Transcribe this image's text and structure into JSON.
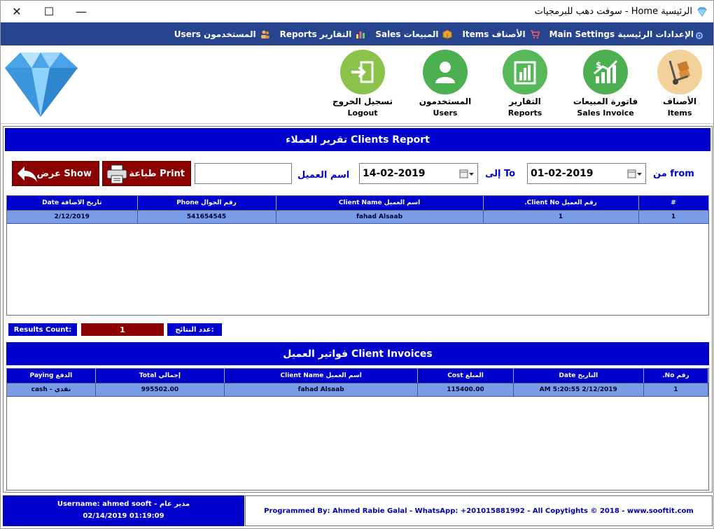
{
  "window": {
    "title": "الرئيسية Home - سوفت دهب للبرمجيات",
    "minimize_glyph": "—",
    "maximize_glyph": "☐",
    "close_glyph": "✕"
  },
  "menu": {
    "items": [
      {
        "label": "الإعدادات الرئيسية Main Settings",
        "icon": "gear-icon"
      },
      {
        "label": "الأصناف Items",
        "icon": "cart-icon"
      },
      {
        "label": "المبيعات Sales",
        "icon": "box-icon"
      },
      {
        "label": "التقارير Reports",
        "icon": "chart-icon"
      },
      {
        "label": "المستخدمون Users",
        "icon": "users-icon"
      }
    ]
  },
  "toolbar": {
    "items": {
      "ar": "الأصناف",
      "en": "Items"
    },
    "sales": {
      "ar": "فاتورة المبيعات",
      "en": "Sales Invoice"
    },
    "reports": {
      "ar": "التقارير",
      "en": "Reports"
    },
    "users": {
      "ar": "المستخدمون",
      "en": "Users"
    },
    "logout": {
      "ar": "تسجيل الخروج",
      "en": "Logout"
    }
  },
  "report": {
    "header": "تقرير العملاء Clients Report",
    "from_label": "من from",
    "from_date": "01-02-2019",
    "to_label": "إلى To",
    "to_date": "14-02-2019",
    "client_name_label": "اسم العميل",
    "client_name_value": "",
    "print_label": "طباعة Print",
    "show_label": "عرض Show",
    "clients_columns": [
      "#",
      "رقم العميل Client No.",
      "اسم العميل Client Name",
      "رقم الجوال Phone",
      "تاريخ الاضافة Date"
    ],
    "clients_rows": [
      [
        "1",
        "1",
        "fahad Alsaab",
        "541654545",
        "2/12/2019"
      ]
    ],
    "results_count_ar": "عدد النتائج:",
    "results_count_value": "1",
    "results_count_en": "Results Count:",
    "invoices_header": "فواتير العميل Client Invoices",
    "invoices_columns": [
      "رقم No.",
      "التاريخ Date",
      "المبلغ Cost",
      "اسم العميل Client Name",
      "إجمالي Total",
      "الدفع Paying"
    ],
    "invoices_rows": [
      [
        "1",
        "2/12/2019 5:20:55 AM",
        "115400.00",
        "fahad Alsaab",
        "995502.00",
        "نقدي - cash"
      ]
    ]
  },
  "footer": {
    "username_line": "Username: ahmed sooft - مدير عام",
    "datetime": "02/14/2019 01:19:09",
    "credits": "Programmed By: Ahmed Rabie Galal - WhatsApp: +201015881992 - All Copytights © 2018 - www.sooftit.com"
  },
  "colors": {
    "menu_bg": "#27458f",
    "header_blue": "#0000cc",
    "button_red": "#8b0000",
    "row_blue": "#7a9be6"
  }
}
